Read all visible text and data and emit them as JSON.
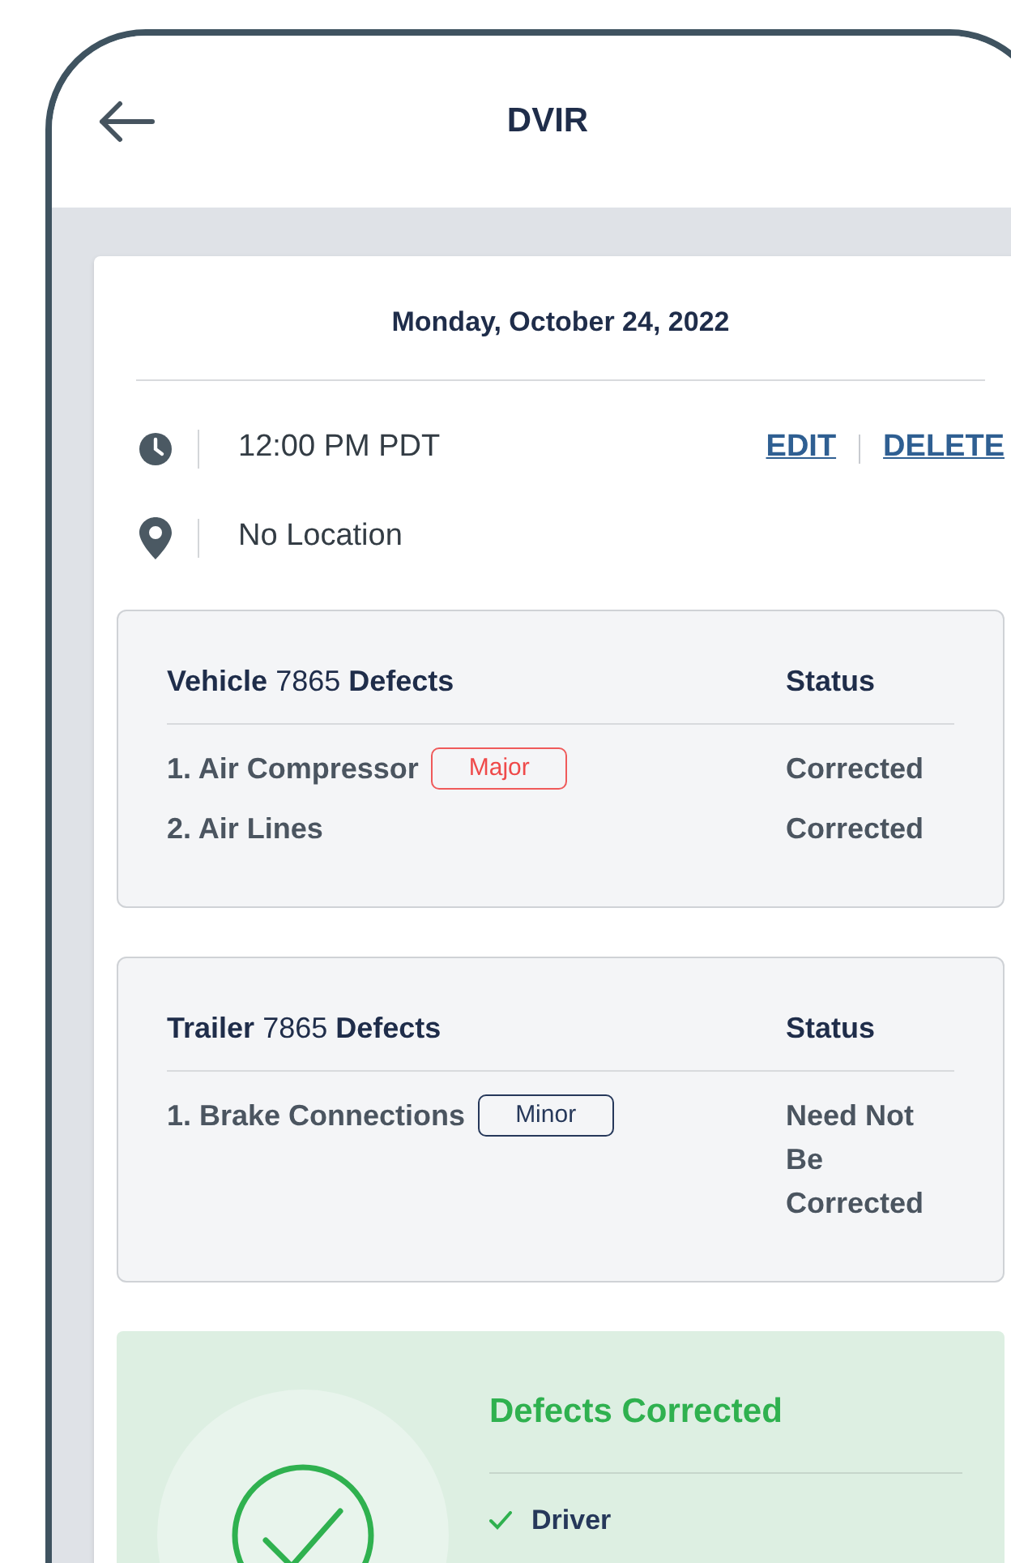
{
  "header": {
    "title": "DVIR"
  },
  "date": "Monday, October 24, 2022",
  "time": "12:00 PM PDT",
  "location": "No Location",
  "actions": [
    "EDIT",
    "DELETE"
  ],
  "defect_groups": [
    {
      "unit": "Vehicle",
      "number": "7865",
      "label": "Defects",
      "status_heading": "Status",
      "items": [
        {
          "name": "1. Air Compressor",
          "severity": "Major",
          "kind": "major",
          "status": "Corrected"
        },
        {
          "name": "2. Air Lines",
          "status": "Corrected"
        }
      ]
    },
    {
      "unit": "Trailer",
      "number": "7865",
      "label": "Defects",
      "status_heading": "Status",
      "items": [
        {
          "name": "1. Brake Connections",
          "severity": "Minor",
          "kind": "minor",
          "status": "Need Not Be Corrected"
        }
      ]
    }
  ],
  "result": {
    "title": "Defects Corrected",
    "signers": [
      "Driver"
    ]
  }
}
